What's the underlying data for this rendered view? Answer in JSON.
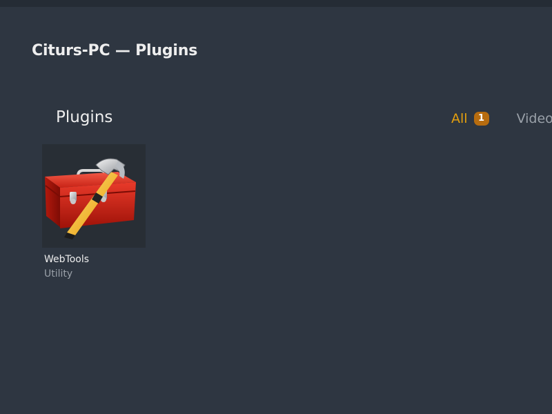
{
  "window": {
    "title": "Citurs-PC — Plugins"
  },
  "section": {
    "title": "Plugins"
  },
  "filters": {
    "all_label": "All",
    "all_count": "1",
    "video_label": "Video"
  },
  "plugins": [
    {
      "name": "WebTools",
      "type": "Utility",
      "icon": "toolbox-hammer-icon"
    }
  ],
  "colors": {
    "background": "#2e3641",
    "accent": "#e5a00d",
    "badge": "#b76c0f",
    "text": "#eeeeee",
    "muted_text": "#9aa1a9"
  }
}
